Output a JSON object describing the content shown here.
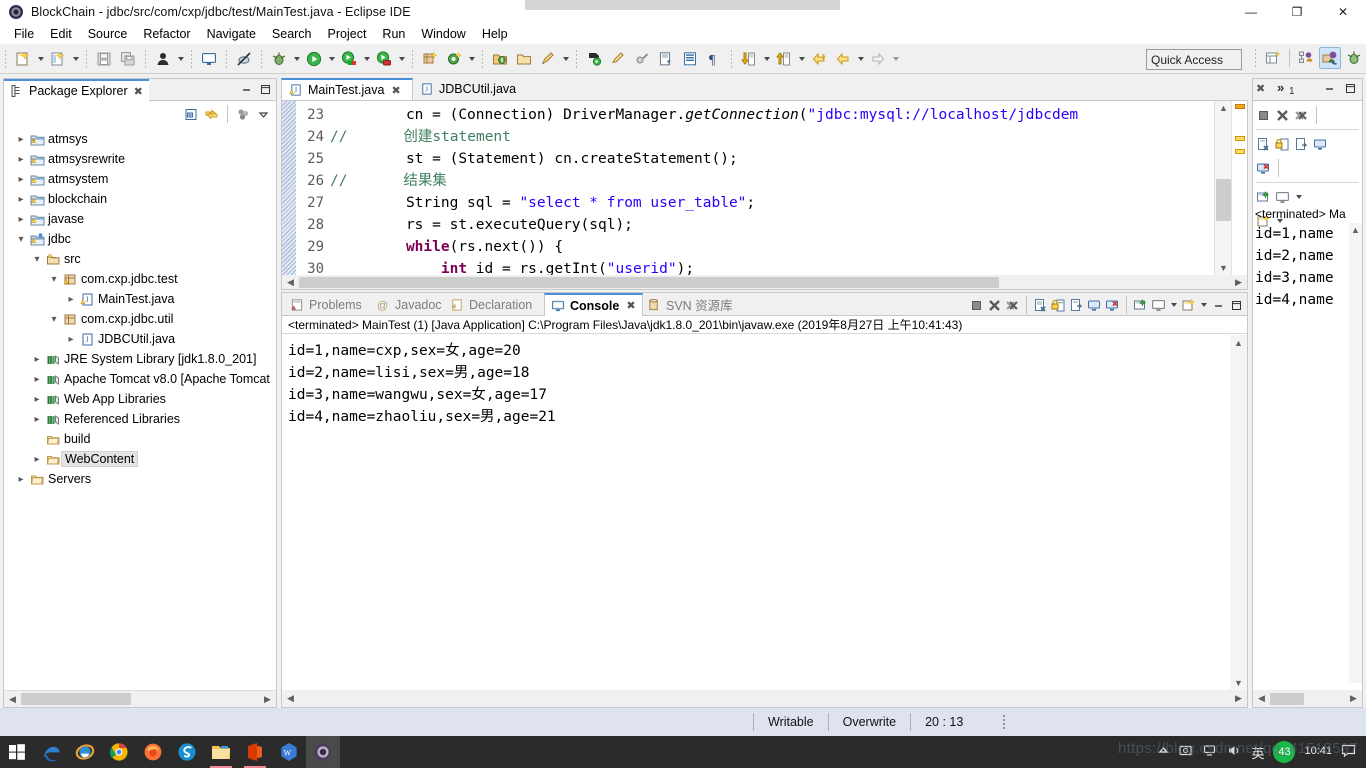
{
  "window": {
    "title": "BlockChain - jdbc/src/com/cxp/jdbc/test/MainTest.java - Eclipse IDE",
    "app_icon": "eclipse-icon",
    "minimize": "—",
    "maximize": "❐",
    "close": "✕"
  },
  "menubar": {
    "items": [
      {
        "label": "File"
      },
      {
        "label": "Edit"
      },
      {
        "label": "Source"
      },
      {
        "label": "Refactor"
      },
      {
        "label": "Navigate"
      },
      {
        "label": "Search"
      },
      {
        "label": "Project"
      },
      {
        "label": "Run"
      },
      {
        "label": "Window"
      },
      {
        "label": "Help"
      }
    ]
  },
  "toolbar": {
    "quick_access_placeholder": "Quick Access",
    "buttons": [
      "new-wizard-icon",
      "new-java-project-icon",
      "save-icon",
      "save-all-icon",
      "person-icon",
      "open-console-icon",
      "skip-breakpoints-icon",
      "debug-icon",
      "run-icon",
      "run-last-tool-icon",
      "external-tools-icon",
      "new-package-icon",
      "new-class-icon",
      "open-type-icon",
      "open-task-icon",
      "search-icon",
      "toggle-mark-occurrences-icon",
      "restore-icon",
      "next-annotation-icon",
      "previous-annotation-icon",
      "pilcrow-icon",
      "back-icon",
      "forward-icon",
      "java-perspective-icon",
      "debug-perspective-icon"
    ],
    "perspective_buttons": [
      "open-perspective-icon",
      "java-ee-perspective-icon",
      "java-perspective-icon",
      "debug-perspective-icon"
    ]
  },
  "package_explorer": {
    "tab_label": "Package Explorer",
    "tab_icon": "package-explorer-icon",
    "close_glyph": "✖",
    "toolbar": [
      "collapse-all-icon",
      "link-with-editor-icon",
      "view-menu-icon",
      "chevron-down-icon"
    ],
    "minimize_glyph": "–",
    "maximize_glyph": "❐",
    "tree": [
      {
        "label": "atmsys",
        "indent": 0,
        "twist": "collapsed",
        "icon": "java-project-warning-icon"
      },
      {
        "label": "atmsysrewrite",
        "indent": 0,
        "twist": "collapsed",
        "icon": "java-project-warning-icon"
      },
      {
        "label": "atmsystem",
        "indent": 0,
        "twist": "collapsed",
        "icon": "java-project-warning-icon"
      },
      {
        "label": "blockchain",
        "indent": 0,
        "twist": "collapsed",
        "icon": "java-project-warning-icon"
      },
      {
        "label": "javase",
        "indent": 0,
        "twist": "collapsed",
        "icon": "java-project-warning-icon"
      },
      {
        "label": "jdbc",
        "indent": 0,
        "twist": "expanded",
        "icon": "java-project-warning-icon"
      },
      {
        "label": "src",
        "indent": 1,
        "twist": "expanded",
        "icon": "source-folder-icon"
      },
      {
        "label": "com.cxp.jdbc.test",
        "indent": 2,
        "twist": "expanded",
        "icon": "package-warning-icon"
      },
      {
        "label": "MainTest.java",
        "indent": 3,
        "twist": "collapsed",
        "icon": "java-file-warning-icon"
      },
      {
        "label": "com.cxp.jdbc.util",
        "indent": 2,
        "twist": "expanded",
        "icon": "package-icon"
      },
      {
        "label": "JDBCUtil.java",
        "indent": 3,
        "twist": "collapsed",
        "icon": "java-file-icon"
      },
      {
        "label": "JRE System Library [jdk1.8.0_201]",
        "indent": 1,
        "twist": "collapsed",
        "icon": "library-icon"
      },
      {
        "label": "Apache Tomcat v8.0 [Apache Tomcat",
        "indent": 1,
        "twist": "collapsed",
        "icon": "library-icon"
      },
      {
        "label": "Web App Libraries",
        "indent": 1,
        "twist": "collapsed",
        "icon": "library-icon"
      },
      {
        "label": "Referenced Libraries",
        "indent": 1,
        "twist": "collapsed",
        "icon": "library-icon"
      },
      {
        "label": "build",
        "indent": 1,
        "twist": "none",
        "icon": "folder-icon"
      },
      {
        "label": "WebContent",
        "indent": 1,
        "twist": "collapsed",
        "icon": "folder-icon",
        "selected": true
      },
      {
        "label": "Servers",
        "indent": 0,
        "twist": "collapsed",
        "icon": "folder-icon"
      }
    ]
  },
  "editor": {
    "tabs": [
      {
        "label": "MainTest.java",
        "icon": "java-file-warning-icon",
        "active": true,
        "close_glyph": "✖"
      },
      {
        "label": "JDBCUtil.java",
        "icon": "java-file-icon",
        "active": false,
        "close_glyph": ""
      }
    ],
    "first_line_number": 23,
    "lines": [
      {
        "num": "23",
        "comment": "",
        "code": "            cn = (Connection) DriverManager.getConnection(\"jdbc:mysql://localhost/jdbcdem"
      },
      {
        "num": "24",
        "comment": "//",
        "code": "        创建statement"
      },
      {
        "num": "25",
        "comment": "",
        "code": "            st = (Statement) cn.createStatement();"
      },
      {
        "num": "26",
        "comment": "//",
        "code": "        结果集"
      },
      {
        "num": "27",
        "comment": "",
        "code": "            String sql = \"select * from user_table\";"
      },
      {
        "num": "28",
        "comment": "",
        "code": "            rs = st.executeQuery(sql);"
      },
      {
        "num": "29",
        "comment": "",
        "code": "            while(rs.next()) {"
      },
      {
        "num": "30",
        "comment": "",
        "code": "                int id = rs.getInt(\"userid\");"
      }
    ]
  },
  "console": {
    "tabs": [
      {
        "label": "Problems",
        "icon": "problems-icon",
        "active": false
      },
      {
        "label": "Javadoc",
        "icon": "javadoc-icon",
        "active": false
      },
      {
        "label": "Declaration",
        "icon": "declaration-icon",
        "active": false
      },
      {
        "label": "Console",
        "icon": "console-icon",
        "active": true,
        "close_glyph": "✖"
      },
      {
        "label": "SVN 资源库",
        "icon": "svn-icon",
        "active": false
      }
    ],
    "toolbar": [
      "terminate-icon",
      "remove-launch-icon",
      "remove-all-terminated-icon",
      "clear-console-icon",
      "scroll-lock-icon",
      "word-wrap-icon",
      "show-console-on-output-icon",
      "show-console-on-error-icon",
      "pin-console-icon",
      "display-selected-console-icon",
      "chevron-down-icon",
      "open-console-icon",
      "chevron-down-icon"
    ],
    "minimize_glyph": "–",
    "maximize_glyph": "❐",
    "subtitle": "<terminated> MainTest (1) [Java Application] C:\\Program Files\\Java\\jdk1.8.0_201\\bin\\javaw.exe (2019年8月27日 上午10:41:43)",
    "output": [
      "id=1,name=cxp,sex=女,age=20",
      "id=2,name=lisi,sex=男,age=18",
      "id=3,name=wangwu,sex=女,age=17",
      "id=4,name=zhaoliu,sex=男,age=21"
    ]
  },
  "right_panel": {
    "close_glyph": "✖",
    "overflow_label": "»",
    "overflow_count": "1",
    "minimize_glyph": "–",
    "maximize_glyph": "❐",
    "toolbar_rows": [
      [
        "terminate-icon",
        "remove-launch-icon",
        "remove-all-terminated-icon"
      ],
      [
        "clear-console-icon",
        "scroll-lock-icon",
        "word-wrap-icon",
        "show-console-on-output-icon"
      ],
      [
        "show-console-on-error-icon"
      ],
      [
        "pin-console-icon",
        "display-selected-console-icon",
        "chevron-down-icon"
      ],
      [
        "open-console-icon",
        "chevron-down-icon"
      ]
    ],
    "subtitle": "<terminated> Ma",
    "output": [
      "id=1,namе",
      "id=2,namе",
      "id=3,namе",
      "id=4,namе"
    ]
  },
  "statusbar": {
    "writable": "Writable",
    "insert_mode": "Overwrite",
    "cursor_position": "20 : 13"
  },
  "taskbar": {
    "items": [
      {
        "name": "start-button-icon"
      },
      {
        "name": "edge-browser-icon"
      },
      {
        "name": "internet-explorer-icon"
      },
      {
        "name": "chrome-browser-icon"
      },
      {
        "name": "firefox-browser-icon"
      },
      {
        "name": "sogou-browser-icon"
      },
      {
        "name": "file-explorer-icon",
        "running": true
      },
      {
        "name": "office-icon",
        "running": true
      },
      {
        "name": "wps-icon"
      },
      {
        "name": "eclipse-icon",
        "selected": true
      }
    ],
    "tray": {
      "icons": [
        "show-hidden-icons-icon",
        "screenshot-icon",
        "network-icon",
        "volume-icon"
      ],
      "ime": "英",
      "badge": "43",
      "time": "10:41",
      "notification": "notification-icon"
    }
  },
  "watermark": "https://blog.csdn.net/qq_41518597",
  "colors": {
    "accent": "#4a90d9",
    "keyword": "#7f0055",
    "string": "#2a00ff",
    "comment": "#3f7f5f",
    "statusbar_bg": "#dfe3f0",
    "taskbar_bg": "#2b2b2b"
  }
}
